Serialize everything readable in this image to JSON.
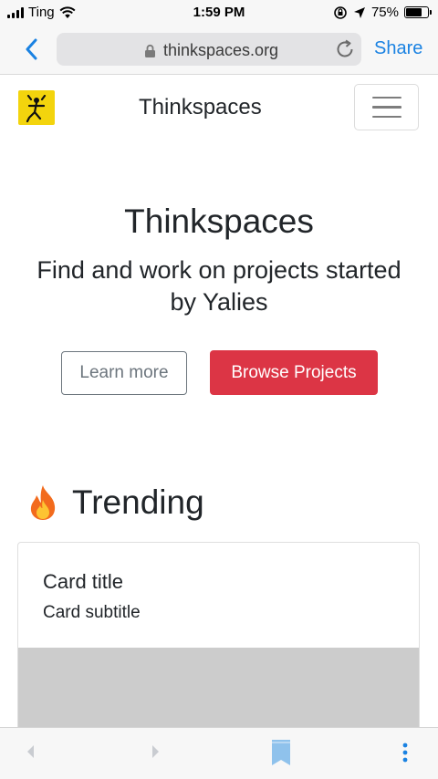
{
  "status_bar": {
    "carrier": "Ting",
    "time": "1:59 PM",
    "battery_percent": "75%",
    "battery_level": 0.75
  },
  "browser": {
    "url": "thinkspaces.org",
    "share_label": "Share",
    "accent_color": "#1a82e2"
  },
  "navbar": {
    "brand": "Thinkspaces",
    "logo_color": "#f3d40d"
  },
  "hero": {
    "title": "Thinkspaces",
    "subtitle": "Find and work on projects started by Yalies",
    "learn_more_label": "Learn more",
    "browse_label": "Browse Projects",
    "browse_color": "#dc3545"
  },
  "trending": {
    "icon": "fire-icon",
    "title": "Trending"
  },
  "card": {
    "title": "Card title",
    "subtitle": "Card subtitle"
  },
  "bottom_bar": {
    "icons": [
      "back-arrow-icon",
      "forward-arrow-icon",
      "bookmark-icon",
      "more-icon"
    ]
  }
}
